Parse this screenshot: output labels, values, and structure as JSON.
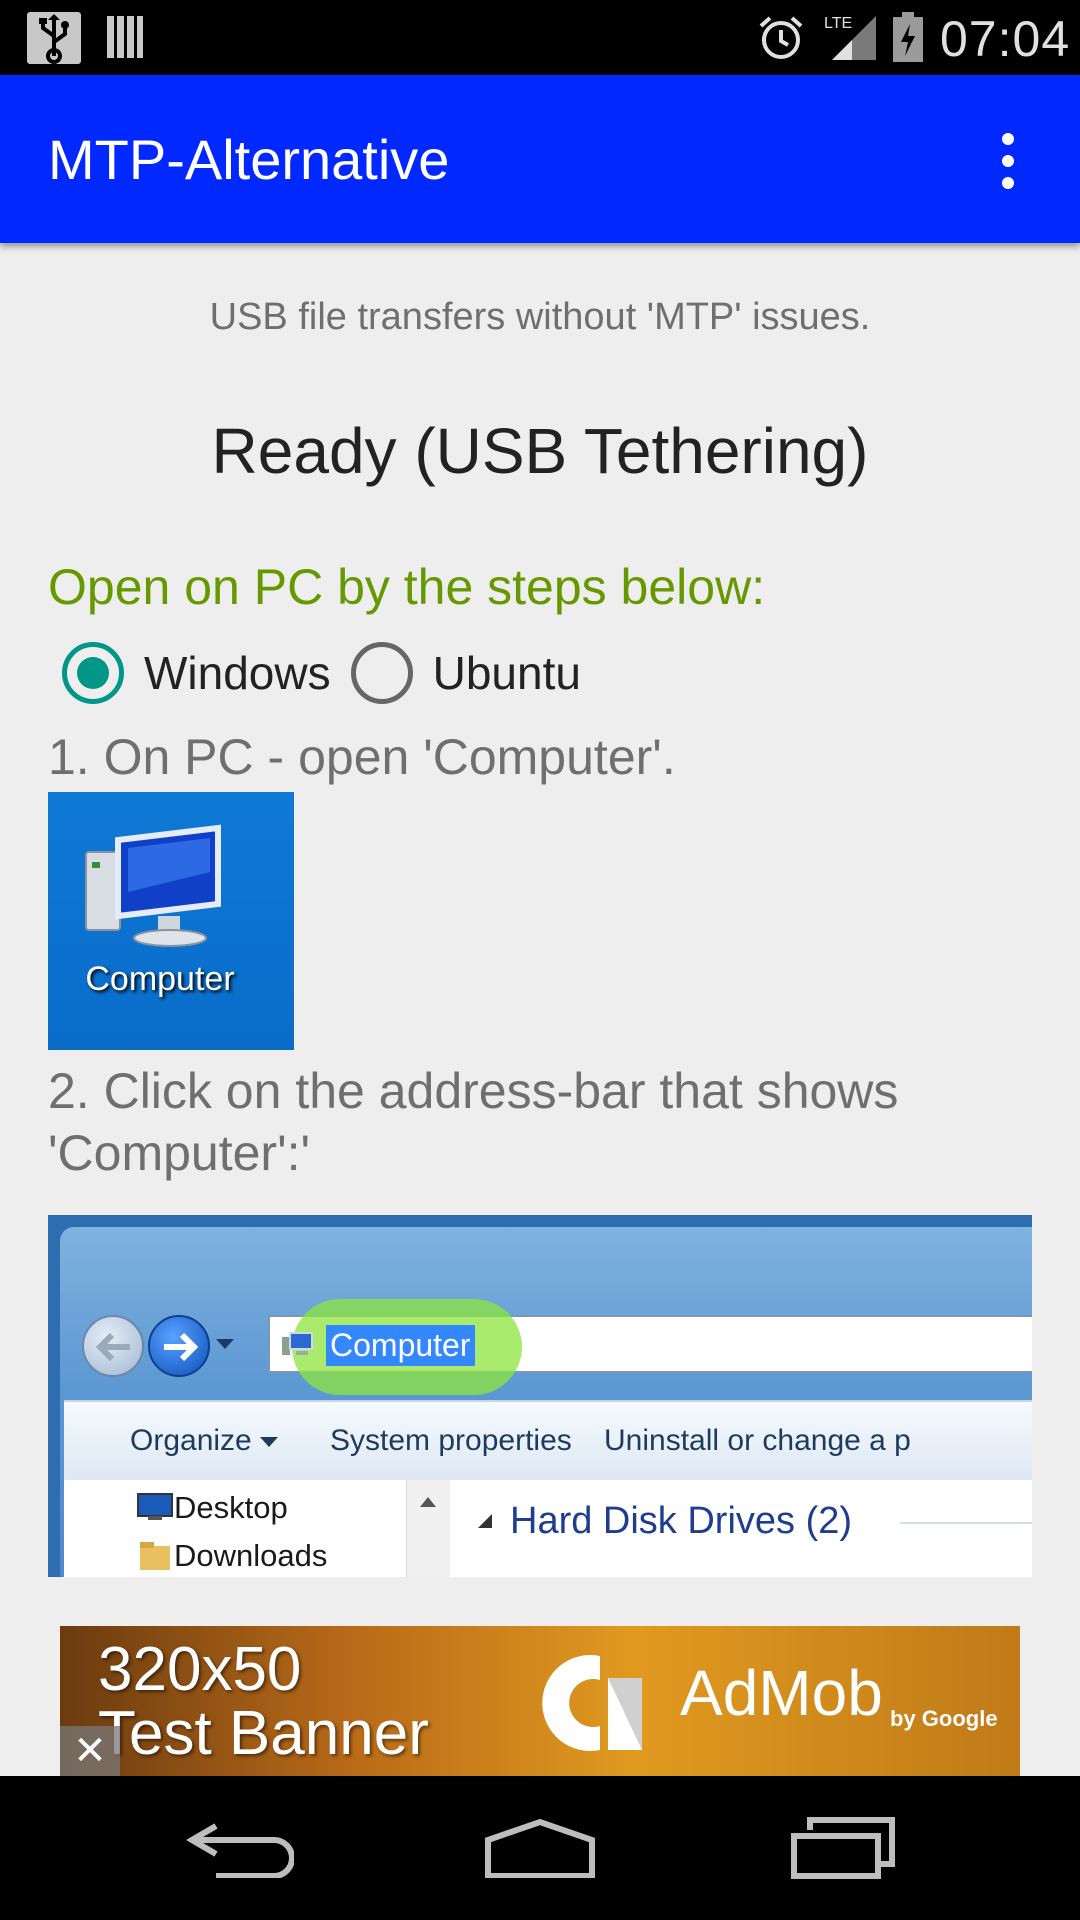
{
  "status_bar": {
    "time": "07:04",
    "icons": [
      "usb-icon",
      "storage-icon",
      "alarm-icon",
      "lte-signal-icon",
      "battery-icon"
    ]
  },
  "app_bar": {
    "title": "MTP-Alternative",
    "menu_icon": "overflow-menu-icon",
    "color": "#0028ff"
  },
  "main": {
    "subtitle": "USB file transfers without 'MTP' issues.",
    "status": "Ready (USB Tethering)",
    "steps_header": "Open on PC by the steps below:",
    "os_options": [
      {
        "label": "Windows",
        "selected": true
      },
      {
        "label": "Ubuntu",
        "selected": false
      }
    ],
    "step1": "1. On PC - open 'Computer'.",
    "computer_icon_label": "Computer",
    "step2": "2. Click on the address-bar that shows 'Computer':'",
    "explorer": {
      "address_text": "Computer",
      "toolbar": [
        "Organize",
        "System properties",
        "Uninstall or change a p"
      ],
      "nav_items": [
        "Desktop",
        "Downloads"
      ],
      "group_label": "Hard Disk Drives (2)"
    }
  },
  "ad": {
    "line1": "320x50",
    "line2": "Test Banner",
    "brand": "AdMob",
    "brand_sub": "by Google",
    "close_label": "✕"
  },
  "nav_bar": {
    "buttons": [
      "back-icon",
      "home-icon",
      "recent-apps-icon"
    ]
  },
  "colors": {
    "accent_green": "#669900",
    "radio_teal": "#009688"
  }
}
